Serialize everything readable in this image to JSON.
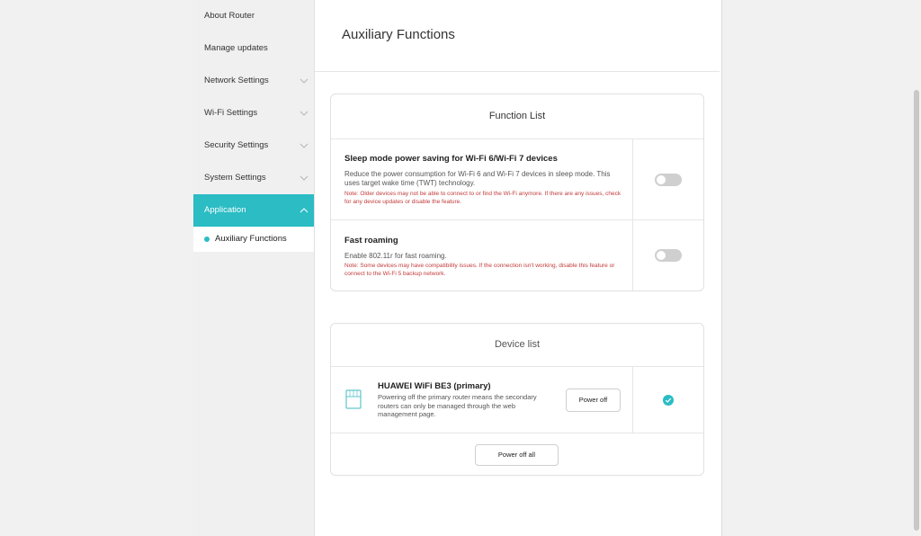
{
  "sidebar": {
    "items": [
      {
        "label": "About Router",
        "has_chevron": false
      },
      {
        "label": "Manage updates",
        "has_chevron": false
      },
      {
        "label": "Network Settings",
        "has_chevron": true
      },
      {
        "label": "Wi-Fi Settings",
        "has_chevron": true
      },
      {
        "label": "Security Settings",
        "has_chevron": true
      },
      {
        "label": "System Settings",
        "has_chevron": true
      },
      {
        "label": "Application",
        "has_chevron": true,
        "active": true
      }
    ],
    "sub_items": [
      {
        "label": "Auxiliary Functions"
      }
    ]
  },
  "page": {
    "title": "Auxiliary Functions"
  },
  "function_list": {
    "title": "Function List",
    "items": [
      {
        "title": "Sleep mode power saving for Wi-Fi 6/Wi-Fi 7 devices",
        "description": "Reduce the power consumption for Wi-Fi 6 and Wi-Fi 7 devices in sleep mode. This uses target wake time (TWT) technology.",
        "note": "Note: Older devices may not be able to connect to or find the Wi-Fi anymore. If there are any issues, check for any device updates or disable the feature.",
        "enabled": false
      },
      {
        "title": "Fast roaming",
        "description": "Enable 802.11r for fast roaming.",
        "note": "Note: Some devices may have compatibility issues. If the connection isn't working, disable this feature or connect to the Wi-Fi 5 backup network.",
        "enabled": false
      }
    ]
  },
  "device_list": {
    "title": "Device list",
    "devices": [
      {
        "name": "HUAWEI WiFi BE3 (primary)",
        "description": "Powering off the primary router means the secondary routers can only be managed through the web management page.",
        "power_off_label": "Power off",
        "selected": true,
        "icon": "router-icon"
      }
    ],
    "power_off_all_label": "Power off all"
  },
  "colors": {
    "accent": "#2bbcc4",
    "note": "#c23b3b",
    "toggle_off": "#cfcfcf"
  }
}
